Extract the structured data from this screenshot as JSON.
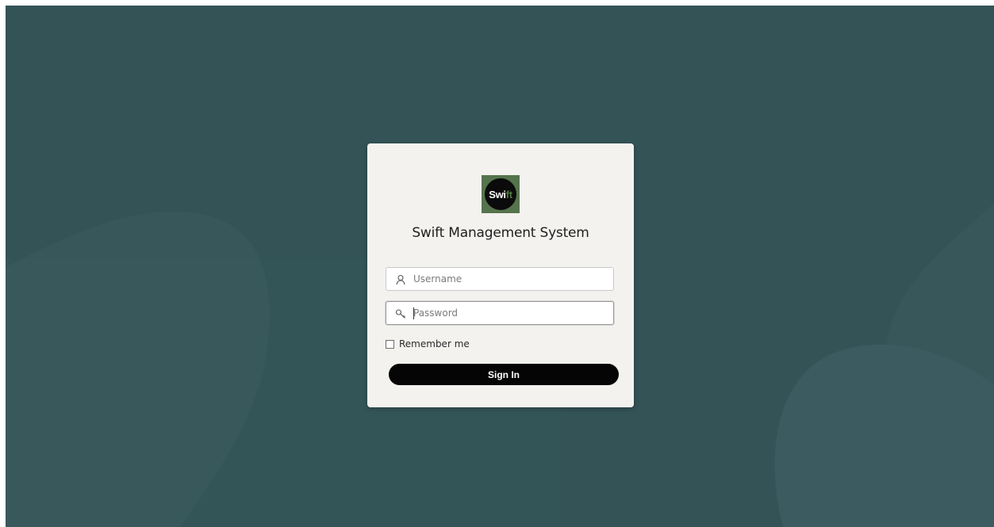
{
  "app": {
    "logo_text_main": "Swi",
    "logo_text_accent": "ft",
    "title": "Swift Management System"
  },
  "form": {
    "username": {
      "value": "",
      "placeholder": "Username",
      "icon": "user-icon"
    },
    "password": {
      "value": "",
      "placeholder": "Password",
      "icon": "key-icon"
    },
    "remember": {
      "label": "Remember me",
      "checked": false
    },
    "submit_label": "Sign In"
  },
  "colors": {
    "background": "#335357",
    "card": "#f3f2ef",
    "logo_bg": "#55734c",
    "button": "#050505"
  }
}
